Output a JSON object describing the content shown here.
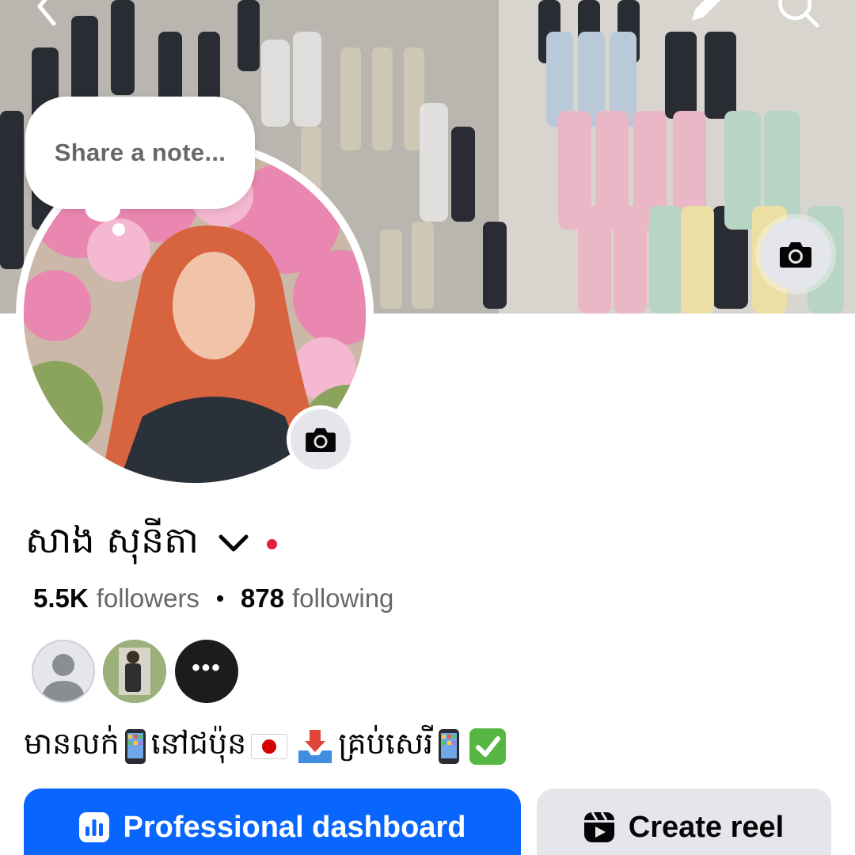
{
  "note": {
    "placeholder": "Share a note..."
  },
  "profile": {
    "name": "សាង សុនីតា",
    "bio": {
      "part1": "មានលក់",
      "part2": "នៅជប៉ុន",
      "part3": "គ្រប់សេរី",
      "icons": [
        "mobile-phone-icon",
        "japan-flag-icon",
        "inbox-tray-icon",
        "mobile-phone-icon",
        "check-mark-icon"
      ]
    }
  },
  "stats": {
    "followers_count": "5.5K",
    "followers_label": "followers",
    "following_count": "878",
    "following_label": "following"
  },
  "follower_avatars": [
    "default-avatar",
    "photo-avatar",
    "more-avatars"
  ],
  "more_dots": "•••",
  "buttons": {
    "primary": "Professional dashboard",
    "secondary": "Create reel"
  },
  "colors": {
    "primary_blue": "#0866ff",
    "secondary_gray": "#e4e6eb",
    "text_secondary": "#65676b",
    "status_red": "#e41e3f"
  }
}
